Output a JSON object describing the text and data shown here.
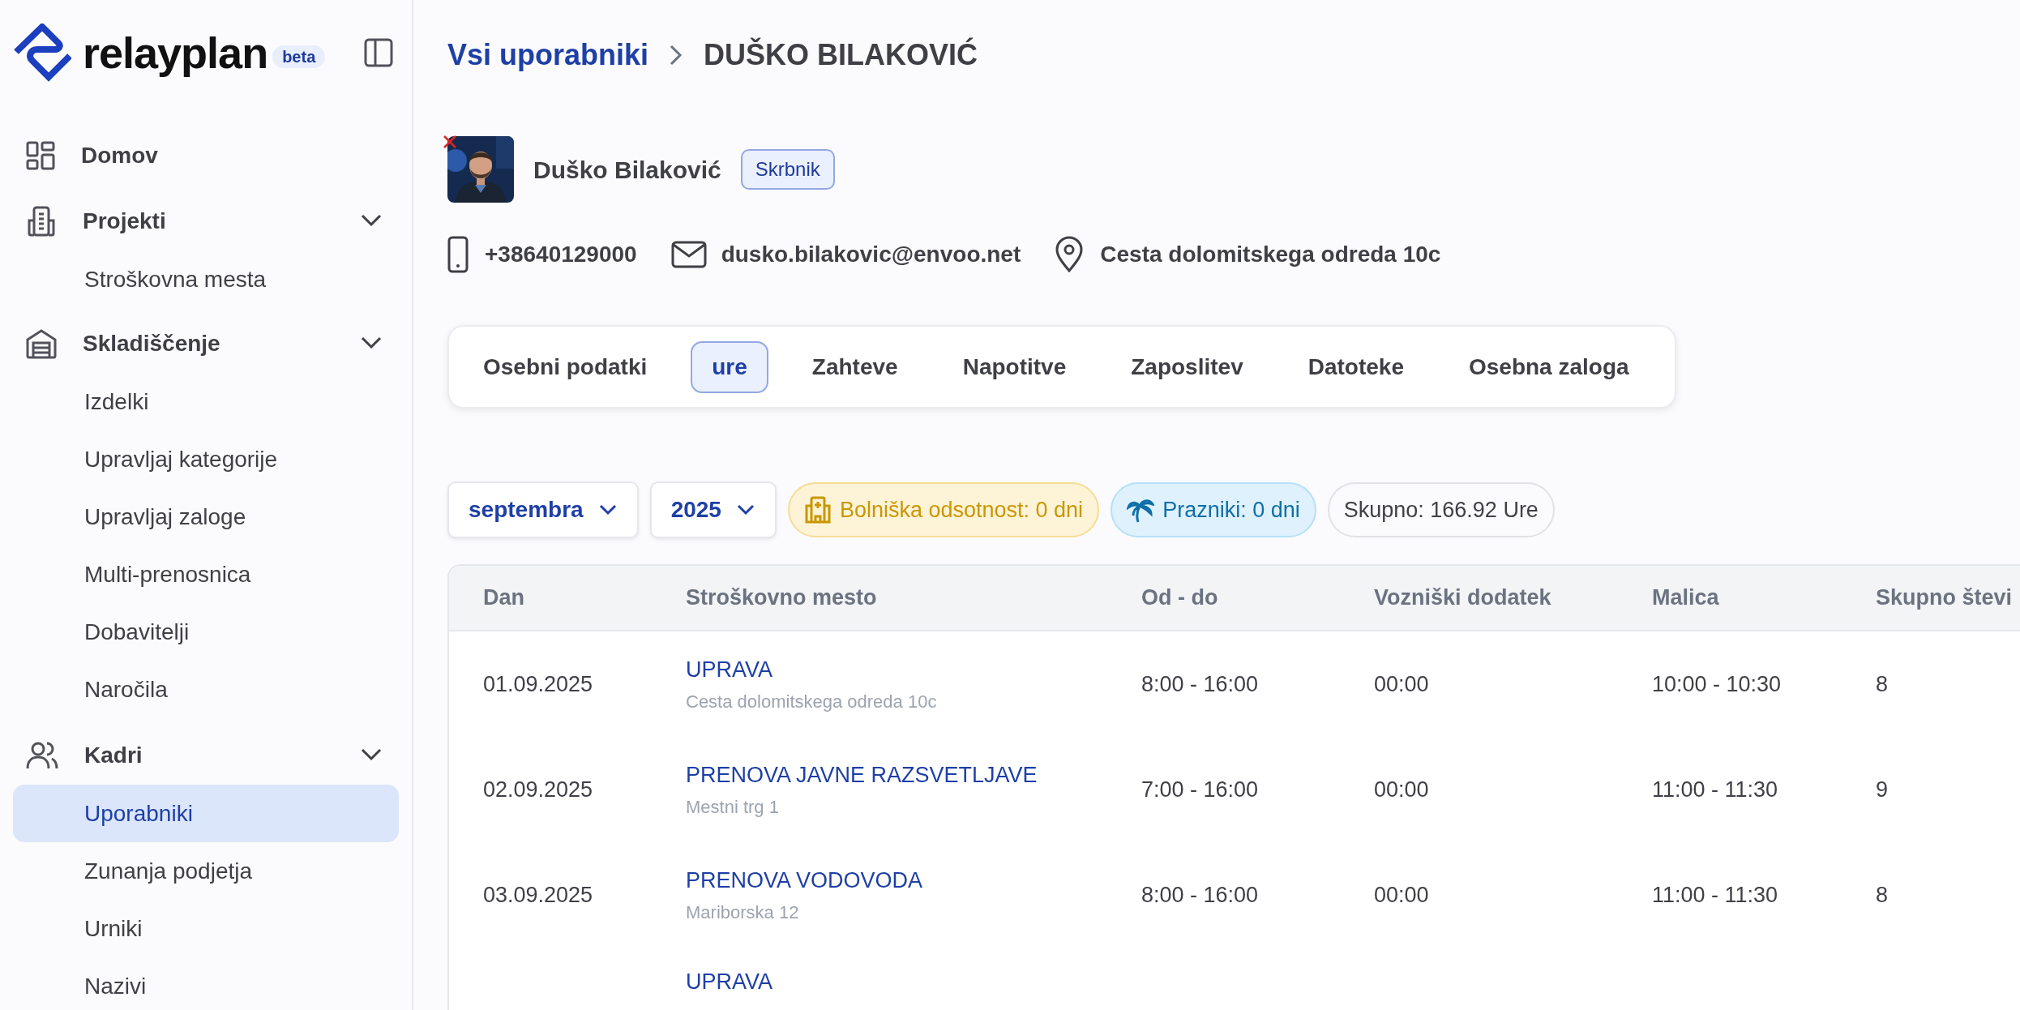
{
  "logo": {
    "text": "relayplan",
    "badge": "beta"
  },
  "sidebar": {
    "items": [
      {
        "label": "Domov",
        "selected": false
      },
      {
        "label": "Projekti",
        "selected": false,
        "expanded": true,
        "children": [
          {
            "label": "Stroškovna mesta",
            "selected": false
          }
        ]
      },
      {
        "label": "Skladiščenje",
        "selected": false,
        "expanded": true,
        "children": [
          {
            "label": "Izdelki",
            "selected": false
          },
          {
            "label": "Upravljaj kategorije",
            "selected": false
          },
          {
            "label": "Upravljaj zaloge",
            "selected": false
          },
          {
            "label": "Multi-prenosnica",
            "selected": false
          },
          {
            "label": "Dobavitelji",
            "selected": false
          },
          {
            "label": "Naročila",
            "selected": false
          }
        ]
      },
      {
        "label": "Kadri",
        "selected": false,
        "expanded": true,
        "children": [
          {
            "label": "Uporabniki",
            "selected": true
          },
          {
            "label": "Zunanja podjetja",
            "selected": false
          },
          {
            "label": "Urniki",
            "selected": false
          },
          {
            "label": "Nazivi",
            "selected": false
          }
        ]
      }
    ]
  },
  "breadcrumb": {
    "link": "Vsi uporabniki",
    "current": "DUŠKO BILAKOVIĆ"
  },
  "profile": {
    "name": "Duško Bilaković",
    "role": "Skrbnik",
    "phone": "+38640129000",
    "email": "dusko.bilakovic@envoo.net",
    "address": "Cesta dolomitskega odreda 10c"
  },
  "tabs": [
    {
      "label": "Osebni podatki",
      "selected": false
    },
    {
      "label": "ure",
      "selected": true
    },
    {
      "label": "Zahteve",
      "selected": false
    },
    {
      "label": "Napotitve",
      "selected": false
    },
    {
      "label": "Zaposlitev",
      "selected": false
    },
    {
      "label": "Datoteke",
      "selected": false
    },
    {
      "label": "Osebna zaloga",
      "selected": false
    }
  ],
  "filters": {
    "month": "septembra",
    "year": "2025",
    "badges": [
      {
        "kind": "sick",
        "text": "Bolniška odsotnost: 0 dni"
      },
      {
        "kind": "holiday",
        "text": "Prazniki: 0 dni"
      },
      {
        "kind": "total",
        "text": "Skupno: 166.92 Ure"
      }
    ]
  },
  "table": {
    "columns": [
      "Dan",
      "Stroškovno mesto",
      "Od - do",
      "Vozniški dodatek",
      "Malica",
      "Skupno števi"
    ],
    "rows": [
      {
        "day": "01.09.2025",
        "cost_center": "UPRAVA",
        "address": "Cesta dolomitskega odreda 10c",
        "from_to": "8:00 - 16:00",
        "driver_bonus": "00:00",
        "lunch": "10:00 - 10:30",
        "total": "8"
      },
      {
        "day": "02.09.2025",
        "cost_center": "PRENOVA JAVNE RAZSVETLJAVE",
        "address": "Mestni trg 1",
        "from_to": "7:00 - 16:00",
        "driver_bonus": "00:00",
        "lunch": "11:00 - 11:30",
        "total": "9"
      },
      {
        "day": "03.09.2025",
        "cost_center": "PRENOVA VODOVODA",
        "address": "Mariborska 12",
        "from_to": "8:00 - 16:00",
        "driver_bonus": "00:00",
        "lunch": "11:00 - 11:30",
        "total": "8"
      },
      {
        "cost_center": "UPRAVA"
      }
    ]
  }
}
